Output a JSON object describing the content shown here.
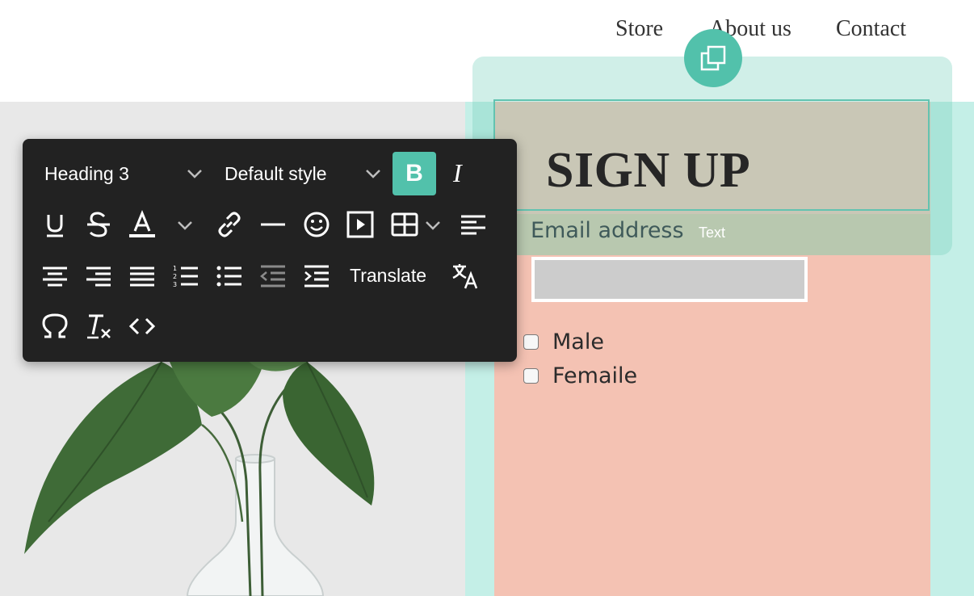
{
  "nav": {
    "store": "Store",
    "about": "About us",
    "contact": "Contact"
  },
  "form": {
    "heading": "SIGN UP",
    "email_label": "Email address",
    "element_tag": "Text",
    "email_value": "",
    "options": [
      "Male",
      "Femaile"
    ]
  },
  "toolbar": {
    "heading_select": "Heading 3",
    "style_select": "Default style",
    "bold": "B",
    "italic": "I",
    "translate": "Translate"
  },
  "colors": {
    "accent": "#52c1ab",
    "toolbar_bg": "#222222",
    "form_bg": "#f4c2b3",
    "column_bg": "#c4efe7"
  }
}
